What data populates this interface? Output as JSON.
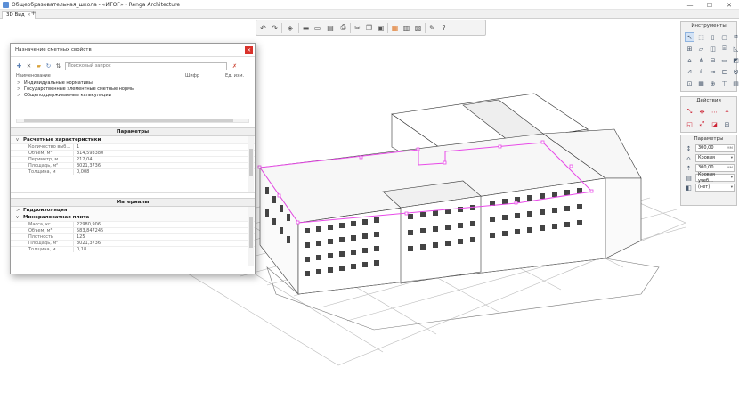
{
  "window": {
    "title": "Общеобразовательная_школа - «ИТОГ» - Renga Architecture",
    "minimize": "—",
    "maximize": "☐",
    "close": "✕"
  },
  "tabs": [
    {
      "label": "3D Вид",
      "close": "×"
    }
  ],
  "tab_add": "+",
  "main_toolbar": {
    "icons": [
      "undo-icon",
      "redo-icon",
      "view-cube-icon",
      "walls-icon",
      "floor-icon",
      "section-icon",
      "print-icon",
      "cut-icon",
      "copy-icon",
      "paste-icon",
      "layers-icon",
      "grid-icon",
      "calc-icon",
      "settings-icon",
      "help-icon"
    ]
  },
  "dialog": {
    "title": "Назначение сметных свойств",
    "close": "✕",
    "search_placeholder": "Поисковый запрос",
    "columns": [
      "Наименование",
      "Шифр",
      "Ед. изм."
    ],
    "tree": [
      {
        "arrow": ">",
        "label": "Индивидуальные нормативы"
      },
      {
        "arrow": ">",
        "label": "Государственные элементные сметные нормы"
      },
      {
        "arrow": ">",
        "label": "Общеподдерживаемые калькуляции"
      }
    ],
    "params_section": "Параметры",
    "params_group": {
      "arrow": "v",
      "label": "Расчетные характеристики",
      "rows": [
        {
          "key": "Количество выб...",
          "value": "1"
        },
        {
          "key": "Объем, м³",
          "value": "314,593380"
        },
        {
          "key": "Периметр, м",
          "value": "212,04"
        },
        {
          "key": "Площадь, м²",
          "value": "3021,3736"
        },
        {
          "key": "Толщина, м",
          "value": "0,008"
        }
      ]
    },
    "materials_section": "Материалы",
    "materials": [
      {
        "arrow": ">",
        "label": "Гидроизоляция",
        "rows": []
      },
      {
        "arrow": "v",
        "label": "Минераловатная плита",
        "rows": [
          {
            "key": "Масса, кг",
            "value": "22980,906"
          },
          {
            "key": "Объем, м³",
            "value": "583,847245"
          },
          {
            "key": "Плотность",
            "value": "125"
          },
          {
            "key": "Площадь, м²",
            "value": "3021,3736"
          },
          {
            "key": "Толщина, м",
            "value": "0,18"
          }
        ]
      }
    ]
  },
  "tools_panel": {
    "title": "Инструменты",
    "icons": [
      "cursor-icon",
      "wall-icon",
      "column-icon",
      "door-icon",
      "beam-icon",
      "window-icon",
      "slab-icon",
      "room-icon",
      "stair-icon",
      "ramp-icon",
      "roof-icon",
      "railing-icon",
      "opening-icon",
      "plate-icon",
      "element-icon",
      "truss-icon",
      "rebar-icon",
      "pipe-icon",
      "duct-icon",
      "equipment-icon",
      "measure-icon",
      "text-icon",
      "axis-icon",
      "level-icon",
      "drawing-icon"
    ]
  },
  "actions_panel": {
    "title": "Действия",
    "icons": [
      "move-icon",
      "rotate-icon",
      "mirror-icon",
      "scale-icon",
      "array-icon",
      "copy-icon",
      "align-icon",
      "delete-icon"
    ]
  },
  "params_panel": {
    "title": "Параметры",
    "fields": [
      {
        "icon": "height-icon",
        "value": "300,00",
        "suffix": "мм"
      },
      {
        "icon": "roof-level-icon",
        "value": "Кровля",
        "suffix": "▾"
      },
      {
        "icon": "offset-icon",
        "value": "300,00",
        "suffix": "мм"
      },
      {
        "icon": "style-icon",
        "value": "Кровля учеб...",
        "suffix": "▾"
      },
      {
        "icon": "material-icon",
        "value": "(нет)",
        "suffix": "▾"
      }
    ]
  },
  "colors": {
    "selection": "#e84ae8",
    "close_red": "#d9322b",
    "accent": "#5b8fd6"
  }
}
